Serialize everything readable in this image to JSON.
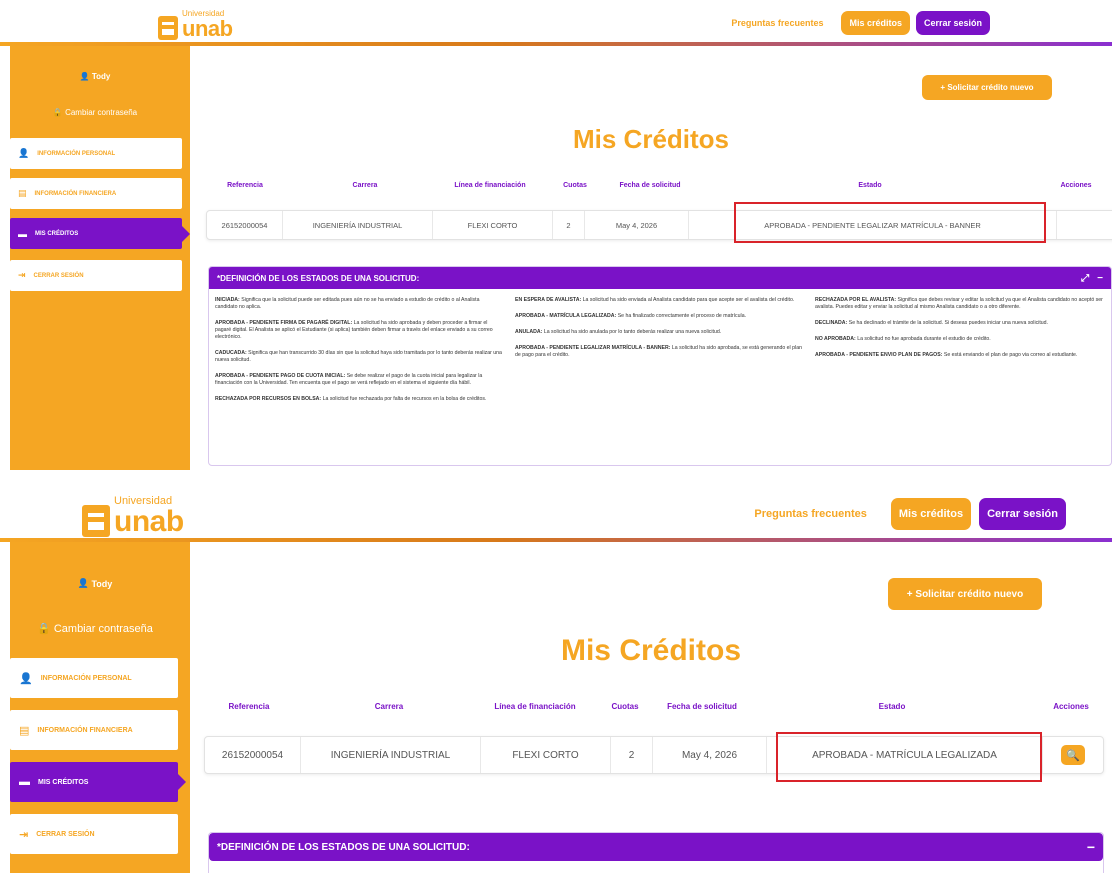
{
  "screens": [
    {
      "logo": {
        "small": "Universidad",
        "big": "unab"
      },
      "nav": {
        "faq": "Preguntas frecuentes",
        "credits": "Mis créditos",
        "logout": "Cerrar sesión"
      },
      "sidebar": {
        "user": "Tody",
        "change_password": "Cambiar contraseña",
        "items": [
          {
            "label": "INFORMACIÓN PERSONAL",
            "icon": "user-icon",
            "active": false
          },
          {
            "label": "INFORMACIÓN FINANCIERA",
            "icon": "document-icon",
            "active": false
          },
          {
            "label": "MIS CRÉDITOS",
            "icon": "card-icon",
            "active": true
          },
          {
            "label": "CERRAR SESIÓN",
            "icon": "logout-icon",
            "active": false
          }
        ]
      },
      "new_credit": "+ Solicitar crédito nuevo",
      "title": "Mis Créditos",
      "table": {
        "headers": [
          "Referencia",
          "Carrera",
          "Línea de financiación",
          "Cuotas",
          "Fecha de solicitud",
          "Estado",
          "Acciones"
        ],
        "row": [
          "26152000054",
          "INGENIERÍA INDUSTRIAL",
          "FLEXI CORTO",
          "2",
          "May 4, 2026",
          "APROBADA - PENDIENTE LEGALIZAR MATRÍCULA - BANNER",
          ""
        ]
      },
      "panel": {
        "title": "*DEFINICIÓN DE LOS ESTADOS DE UNA SOLICITUD:",
        "columns": [
          [
            {
              "term": "INICIADA:",
              "text": "Significa que la solicitud puede ser editada pues aún no se ha enviado a estudio de crédito o al Analista candidato no aplica."
            },
            {
              "term": "APROBADA - PENDIENTE FIRMA DE PAGARÉ DIGITAL:",
              "text": "La solicitud ha sido aprobada y deben proceder a firmar el pagaré digital. El Analista se aplicó el Estudiante (si aplica) también deben firmar a través del enlace enviado a su correo electrónico."
            },
            {
              "term": "CADUCADA:",
              "text": "Significa que han transcurrido 30 días sin que la solicitud haya sido tramitada por lo tanto deberás realizar una nueva solicitud."
            },
            {
              "term": "APROBADA - PENDIENTE PAGO DE CUOTA INICIAL:",
              "text": "Se debe realizar el pago de la cuota inicial para legalizar la financiación con la Universidad. Ten encuenta que el pago se verá reflejado en el sistema el siguiente día hábil."
            },
            {
              "term": "RECHAZADA POR RECURSOS EN BOLSA:",
              "text": "La solicitud fue rechazada por falta de recursos en la bolsa de créditos."
            }
          ],
          [
            {
              "term": "EN ESPERA DE AVALISTA:",
              "text": "La solicitud ha sido enviada al Analista candidato para que acepte ser el avalista del crédito."
            },
            {
              "term": "APROBADA - MATRÍCULA LEGALIZADA:",
              "text": "Se ha finalizado correctamente el proceso de matrícula."
            },
            {
              "term": "ANULADA:",
              "text": "La solicitud ha sido anulada por lo tanto deberás realizar una nueva solicitud."
            },
            {
              "term": "APROBADA - PENDIENTE LEGALIZAR MATRÍCULA - BANNER:",
              "text": "La solicitud ha sido aprobada, se está generando el plan de pago para el crédito."
            }
          ],
          [
            {
              "term": "RECHAZADA POR EL AVALISTA:",
              "text": "Significa que debes revisar y editar la solicitud ya que el Analista candidato no aceptó ser avalista. Puedes editar y enviar la solicitud al mismo Analista candidato o a otro diferente."
            },
            {
              "term": "DECLINADA:",
              "text": "Se ha declinado el trámite de la solicitud. Si deseas puedes iniciar una nueva solicitud."
            },
            {
              "term": "NO APROBADA:",
              "text": "La solicitud no fue aprobada durante el estudio de crédito."
            },
            {
              "term": "APROBADA - PENDIENTE ENVIO PLAN DE PAGOS:",
              "text": "Se está enviando el plan de pago via correo al estudiante."
            }
          ]
        ]
      }
    },
    {
      "logo": {
        "small": "Universidad",
        "big": "unab"
      },
      "nav": {
        "faq": "Preguntas frecuentes",
        "credits": "Mis créditos",
        "logout": "Cerrar sesión"
      },
      "sidebar": {
        "user": "Tody",
        "change_password": "Cambiar contraseña",
        "items": [
          {
            "label": "INFORMACIÓN PERSONAL",
            "icon": "user-icon",
            "active": false
          },
          {
            "label": "INFORMACIÓN FINANCIERA",
            "icon": "document-icon",
            "active": false
          },
          {
            "label": "MIS CRÉDITOS",
            "icon": "card-icon",
            "active": true
          },
          {
            "label": "CERRAR SESIÓN",
            "icon": "logout-icon",
            "active": false
          }
        ]
      },
      "new_credit": "+ Solicitar crédito nuevo",
      "title": "Mis Créditos",
      "table": {
        "headers": [
          "Referencia",
          "Carrera",
          "Línea de financiación",
          "Cuotas",
          "Fecha de solicitud",
          "Estado",
          "Acciones"
        ],
        "row": [
          "26152000054",
          "INGENIERÍA INDUSTRIAL",
          "FLEXI CORTO",
          "2",
          "May 4, 2026",
          "APROBADA - MATRÍCULA LEGALIZADA",
          ""
        ]
      },
      "panel": {
        "title": "*DEFINICIÓN DE LOS ESTADOS DE UNA SOLICITUD:"
      }
    }
  ],
  "colors": {
    "orange": "#f5a623",
    "purple": "#7a12c7",
    "highlight": "#d9232a"
  }
}
